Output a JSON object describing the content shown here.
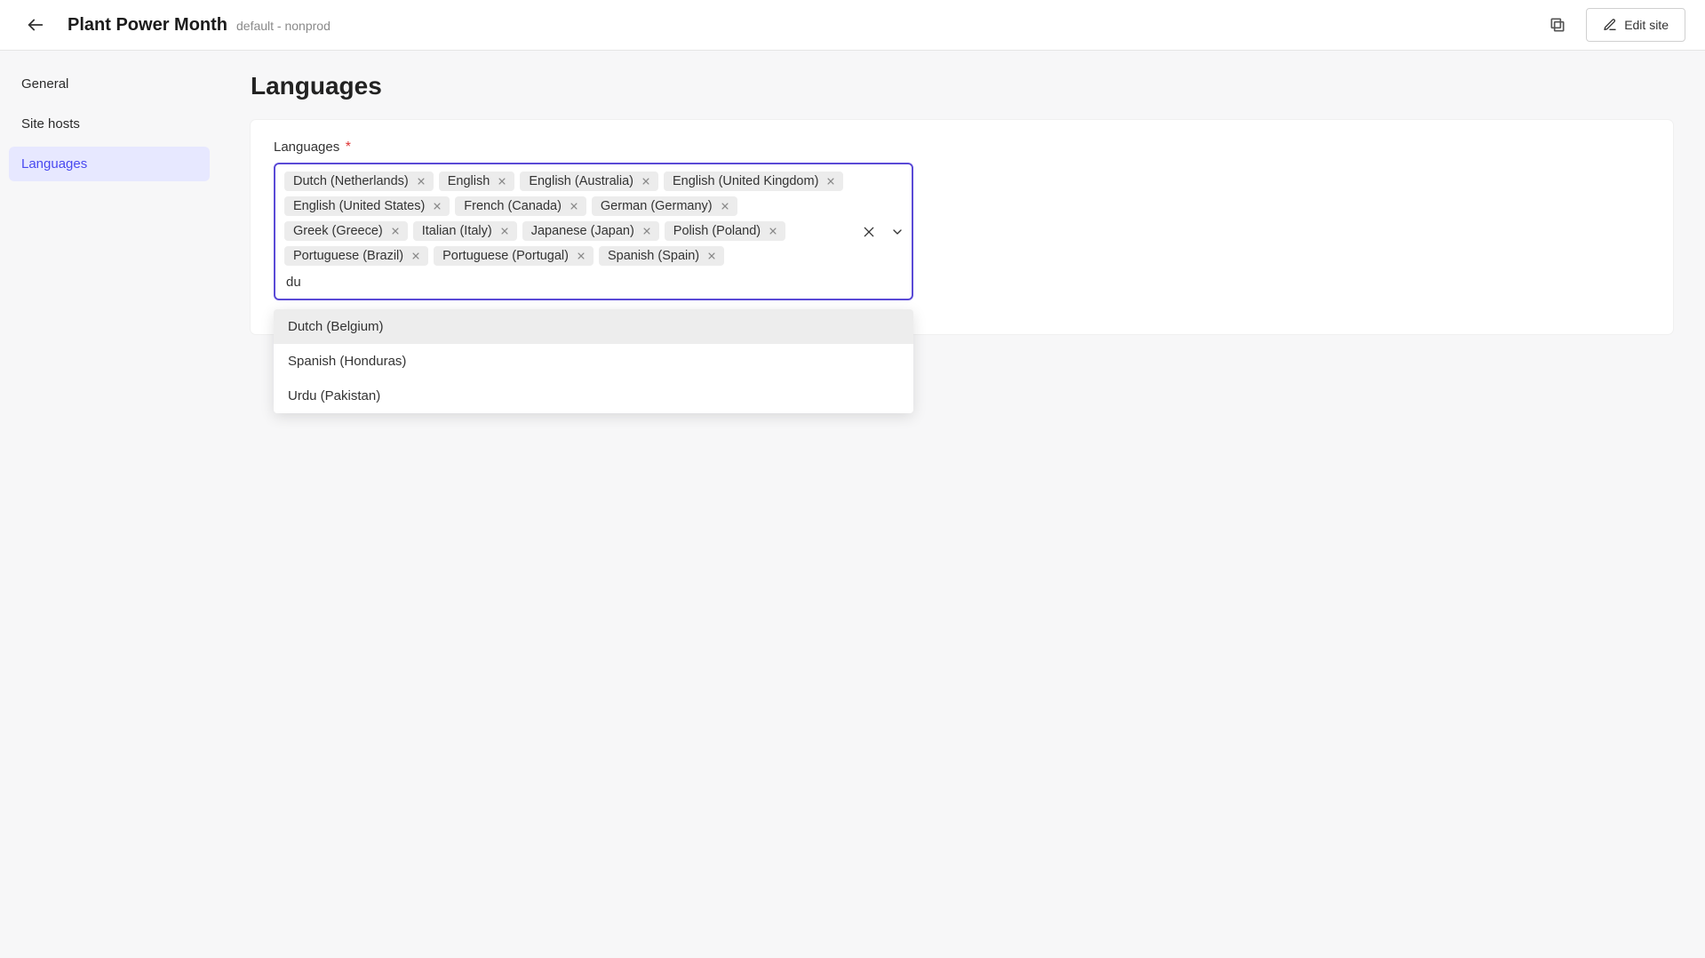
{
  "header": {
    "title": "Plant Power Month",
    "subtitle": "default - nonprod",
    "edit_label": "Edit site"
  },
  "sidebar": {
    "items": [
      {
        "label": "General",
        "id": "general",
        "active": false
      },
      {
        "label": "Site hosts",
        "id": "site-hosts",
        "active": false
      },
      {
        "label": "Languages",
        "id": "languages",
        "active": true
      }
    ]
  },
  "page": {
    "title": "Languages",
    "field_label": "Languages",
    "required_marker": "*",
    "search_value": "du",
    "selected_languages": [
      "Dutch (Netherlands)",
      "English",
      "English (Australia)",
      "English (United Kingdom)",
      "English (United States)",
      "French (Canada)",
      "German (Germany)",
      "Greek (Greece)",
      "Italian (Italy)",
      "Japanese (Japan)",
      "Polish (Poland)",
      "Portuguese (Brazil)",
      "Portuguese (Portugal)",
      "Spanish (Spain)"
    ],
    "dropdown_options": [
      {
        "label": "Dutch (Belgium)",
        "highlighted": true
      },
      {
        "label": "Spanish (Honduras)",
        "highlighted": false
      },
      {
        "label": "Urdu (Pakistan)",
        "highlighted": false
      }
    ]
  }
}
